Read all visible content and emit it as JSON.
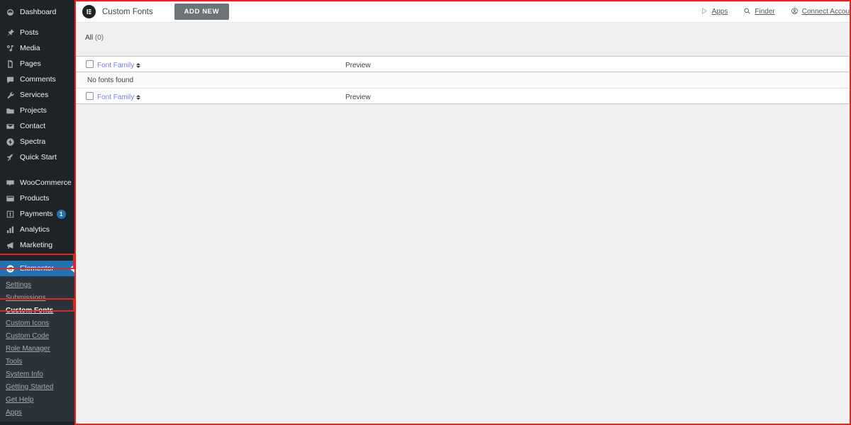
{
  "colors": {
    "annotation": "#e8231f",
    "sidebar_bg": "#1d2327",
    "submenu_bg": "#2c3338",
    "active_blue": "#2271b1",
    "badge_blue": "#2271b1",
    "content_bg": "#f0f0f1",
    "link_purple": "#7a7af0",
    "button_gray": "#6e7377"
  },
  "sidebar": {
    "items": [
      {
        "label": "Dashboard",
        "icon": "dashboard-icon"
      },
      {
        "label": "Posts",
        "icon": "pin-icon"
      },
      {
        "label": "Media",
        "icon": "media-icon"
      },
      {
        "label": "Pages",
        "icon": "pages-icon"
      },
      {
        "label": "Comments",
        "icon": "comments-icon"
      },
      {
        "label": "Services",
        "icon": "wrench-icon"
      },
      {
        "label": "Projects",
        "icon": "folder-icon"
      },
      {
        "label": "Contact",
        "icon": "envelope-icon"
      },
      {
        "label": "Spectra",
        "icon": "spectra-icon"
      },
      {
        "label": "Quick Start",
        "icon": "rocket-icon"
      }
    ],
    "items2": [
      {
        "label": "WooCommerce",
        "icon": "woocommerce-icon"
      },
      {
        "label": "Products",
        "icon": "products-icon"
      },
      {
        "label": "Payments",
        "icon": "payments-icon",
        "badge": "1"
      },
      {
        "label": "Analytics",
        "icon": "analytics-icon"
      },
      {
        "label": "Marketing",
        "icon": "megaphone-icon"
      }
    ],
    "current": {
      "label": "Elementor",
      "icon": "elementor-icon"
    },
    "submenu": [
      {
        "label": "Settings",
        "active": false
      },
      {
        "label": "Submissions",
        "active": false
      },
      {
        "label": "Custom Fonts",
        "active": true
      },
      {
        "label": "Custom Icons",
        "active": false
      },
      {
        "label": "Custom Code",
        "active": false
      },
      {
        "label": "Role Manager",
        "active": false
      },
      {
        "label": "Tools",
        "active": false
      },
      {
        "label": "System Info",
        "active": false
      },
      {
        "label": "Getting Started",
        "active": false
      },
      {
        "label": "Get Help",
        "active": false
      },
      {
        "label": "Apps",
        "active": false
      }
    ]
  },
  "topbar": {
    "logo_icon": "elementor-logo-icon",
    "page_title": "Custom Fonts",
    "add_new_label": "ADD NEW",
    "links": [
      {
        "label": "Apps",
        "icon": "apps-icon"
      },
      {
        "label": "Finder",
        "icon": "search-icon"
      },
      {
        "label": "Connect Accou",
        "icon": "account-icon"
      }
    ]
  },
  "content": {
    "filter_all_label": "All",
    "filter_all_count": "(0)",
    "table": {
      "columns": [
        {
          "key": "cb",
          "label": "",
          "type": "checkbox"
        },
        {
          "key": "font_family",
          "label": "Font Family",
          "type": "sortable"
        },
        {
          "key": "preview",
          "label": "Preview",
          "type": "static"
        }
      ],
      "rows": [],
      "empty_message": "No fonts found"
    }
  }
}
